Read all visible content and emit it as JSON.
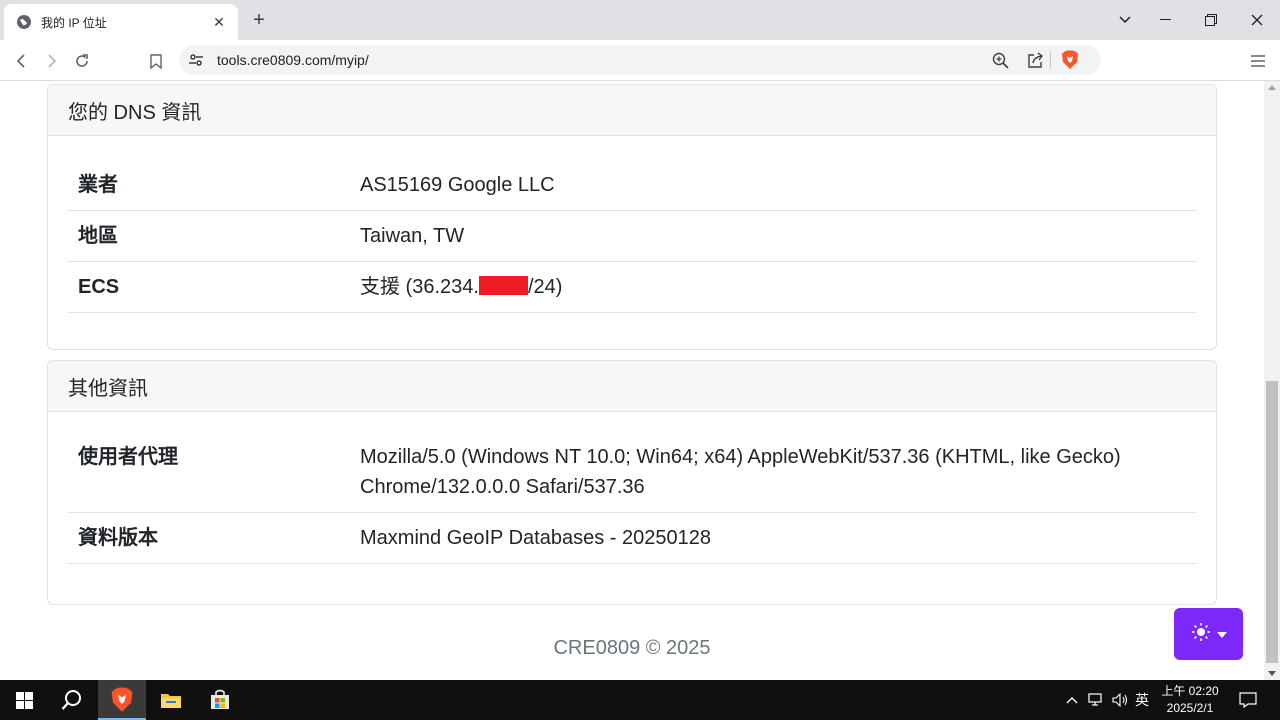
{
  "browser": {
    "tab_title": "我的 IP 位址",
    "url": "tools.cre0809.com/myip/"
  },
  "dns_card": {
    "title": "您的 DNS 資訊",
    "rows": [
      {
        "label": "業者",
        "value": "AS15169 Google LLC"
      },
      {
        "label": "地區",
        "value": "Taiwan, TW"
      },
      {
        "label": "ECS",
        "value_prefix": "支援 (36.234.",
        "value_suffix": "/24)"
      }
    ]
  },
  "other_card": {
    "title": "其他資訊",
    "rows": [
      {
        "label": "使用者代理",
        "value": "Mozilla/5.0 (Windows NT 10.0; Win64; x64) AppleWebKit/537.36 (KHTML, like Gecko) Chrome/132.0.0.0 Safari/537.36"
      },
      {
        "label": "資料版本",
        "value": "Maxmind GeoIP Databases - 20250128"
      }
    ]
  },
  "footer": "CRE0809 © 2025",
  "colors": {
    "theme_button": "#7c28f9",
    "redaction": "#ee1c25",
    "brave_orange": "#fb542b"
  },
  "taskbar": {
    "ime_label": "英",
    "time": "上午 02:20",
    "date": "2025/2/1"
  }
}
